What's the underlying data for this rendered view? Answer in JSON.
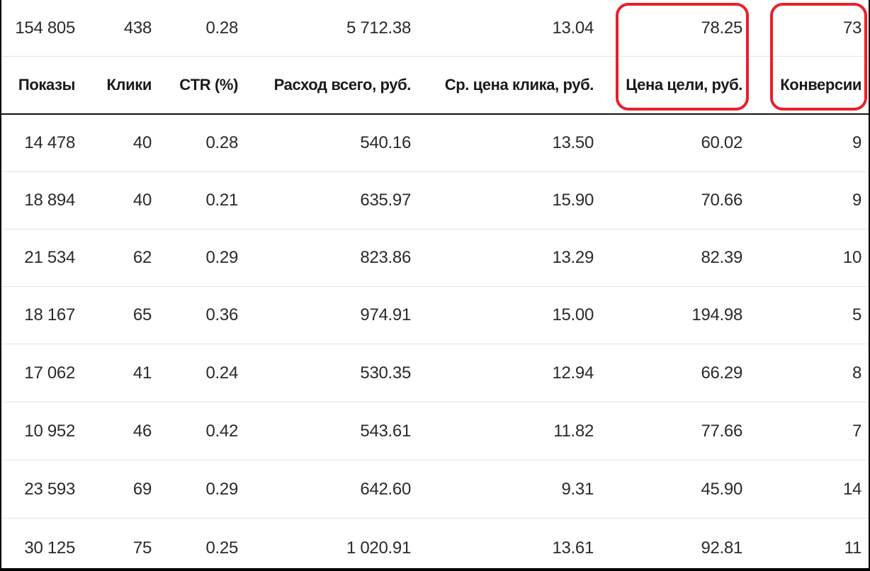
{
  "columns": {
    "impressions": "Показы",
    "clicks": "Клики",
    "ctr": "CTR (%)",
    "cost_total": "Расход всего, руб.",
    "avg_cpc": "Ср. цена клика, руб.",
    "goal_cost": "Цена цели, руб.",
    "conversions": "Конверсии"
  },
  "totals": {
    "impressions": "154 805",
    "clicks": "438",
    "ctr": "0.28",
    "cost_total": "5 712.38",
    "avg_cpc": "13.04",
    "goal_cost": "78.25",
    "conversions": "73"
  },
  "rows": [
    {
      "impressions": "14 478",
      "clicks": "40",
      "ctr": "0.28",
      "cost_total": "540.16",
      "avg_cpc": "13.50",
      "goal_cost": "60.02",
      "conversions": "9"
    },
    {
      "impressions": "18 894",
      "clicks": "40",
      "ctr": "0.21",
      "cost_total": "635.97",
      "avg_cpc": "15.90",
      "goal_cost": "70.66",
      "conversions": "9"
    },
    {
      "impressions": "21 534",
      "clicks": "62",
      "ctr": "0.29",
      "cost_total": "823.86",
      "avg_cpc": "13.29",
      "goal_cost": "82.39",
      "conversions": "10"
    },
    {
      "impressions": "18 167",
      "clicks": "65",
      "ctr": "0.36",
      "cost_total": "974.91",
      "avg_cpc": "15.00",
      "goal_cost": "194.98",
      "conversions": "5"
    },
    {
      "impressions": "17 062",
      "clicks": "41",
      "ctr": "0.24",
      "cost_total": "530.35",
      "avg_cpc": "12.94",
      "goal_cost": "66.29",
      "conversions": "8"
    },
    {
      "impressions": "10 952",
      "clicks": "46",
      "ctr": "0.42",
      "cost_total": "543.61",
      "avg_cpc": "11.82",
      "goal_cost": "77.66",
      "conversions": "7"
    },
    {
      "impressions": "23 593",
      "clicks": "69",
      "ctr": "0.29",
      "cost_total": "642.60",
      "avg_cpc": "9.31",
      "goal_cost": "45.90",
      "conversions": "14"
    },
    {
      "impressions": "30 125",
      "clicks": "75",
      "ctr": "0.25",
      "cost_total": "1 020.91",
      "avg_cpc": "13.61",
      "goal_cost": "92.81",
      "conversions": "11"
    }
  ],
  "highlight_color": "#e8202a"
}
